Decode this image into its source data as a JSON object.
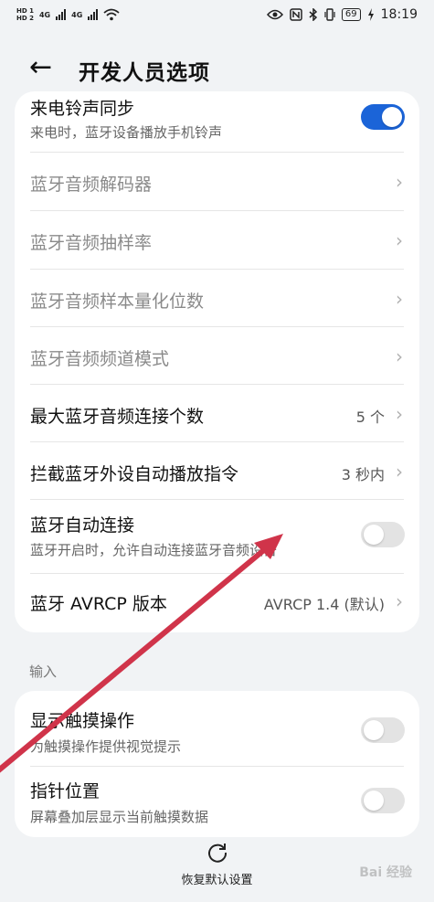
{
  "statusbar": {
    "time": "18:19",
    "battery": "69",
    "sim1": "HD 1",
    "sim2": "HD 2",
    "net1": "4G",
    "net2": "4G"
  },
  "header": {
    "title": "开发人员选项"
  },
  "top_card": {
    "ringtone": {
      "label": "来电铃声同步",
      "sub": "来电时，蓝牙设备播放手机铃声",
      "enabled": true
    },
    "codec": {
      "label": "蓝牙音频解码器"
    },
    "sample_rate": {
      "label": "蓝牙音频抽样率"
    },
    "bits": {
      "label": "蓝牙音频样本量化位数"
    },
    "channel": {
      "label": "蓝牙音频频道模式"
    },
    "max_conn": {
      "label": "最大蓝牙音频连接个数",
      "value": "5 个"
    },
    "intercept": {
      "label": "拦截蓝牙外设自动播放指令",
      "value": "3 秒内"
    },
    "auto_conn": {
      "label": "蓝牙自动连接",
      "sub": "蓝牙开启时，允许自动连接蓝牙音频设备",
      "enabled": false
    },
    "avrcp": {
      "label": "蓝牙 AVRCP 版本",
      "value": "AVRCP 1.4 (默认)"
    }
  },
  "input_section": {
    "label": "输入"
  },
  "input_card": {
    "show_taps": {
      "label": "显示触摸操作",
      "sub": "为触摸操作提供视觉提示",
      "enabled": false
    },
    "pointer": {
      "label": "指针位置",
      "sub": "屏幕叠加层显示当前触摸数据",
      "enabled": false
    }
  },
  "footer": {
    "reset_label": "恢复默认设置"
  },
  "watermark": "Bai 经验",
  "colors": {
    "accent": "#1b64d8",
    "annotation_arrow": "#d0344a"
  }
}
